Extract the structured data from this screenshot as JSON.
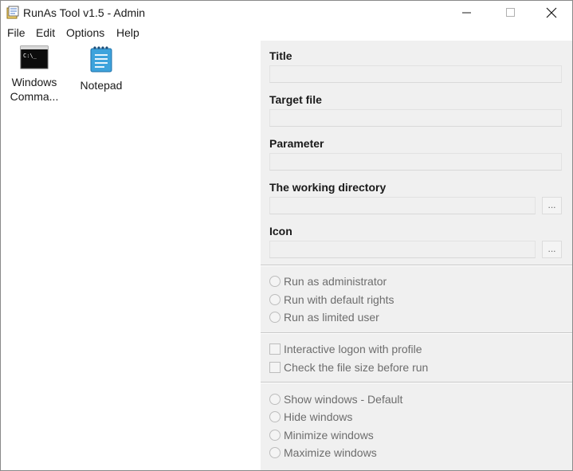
{
  "window": {
    "title": "RunAs Tool v1.5 - Admin"
  },
  "menu": [
    "File",
    "Edit",
    "Options",
    "Help"
  ],
  "shortcuts": [
    {
      "label_line1": "Windows",
      "label_line2": "Comma...",
      "icon": "terminal-icon"
    },
    {
      "label_line1": "Notepad",
      "label_line2": "",
      "icon": "notepad-icon"
    }
  ],
  "form": {
    "title_label": "Title",
    "title_value": "",
    "target_label": "Target file",
    "target_value": "",
    "parameter_label": "Parameter",
    "parameter_value": "",
    "workdir_label": "The working directory",
    "workdir_value": "",
    "icon_label": "Icon",
    "icon_value": "",
    "browse_label": "..."
  },
  "rights_options": [
    "Run as administrator",
    "Run with default rights",
    "Run as limited user"
  ],
  "logon_options": [
    "Interactive logon with profile",
    "Check the file size before run"
  ],
  "window_options": [
    "Show windows - Default",
    "Hide windows",
    "Minimize windows",
    "Maximize windows"
  ]
}
